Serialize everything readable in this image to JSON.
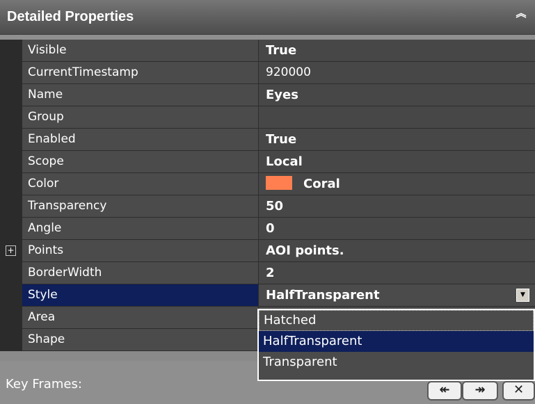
{
  "header": {
    "title": "Detailed Properties",
    "collapse_icon": "double-chevron-up-icon"
  },
  "properties": [
    {
      "name": "Visible",
      "value": "True"
    },
    {
      "name": "CurrentTimestamp",
      "value": "920000"
    },
    {
      "name": "Name",
      "value": "Eyes"
    },
    {
      "name": "Group",
      "value": ""
    },
    {
      "name": "Enabled",
      "value": "True"
    },
    {
      "name": "Scope",
      "value": "Local"
    },
    {
      "name": "Color",
      "value": "Coral",
      "swatch": "#ff7f50"
    },
    {
      "name": "Transparency",
      "value": "50"
    },
    {
      "name": "Angle",
      "value": "0"
    },
    {
      "name": "Points",
      "value": "AOI points.",
      "expander": "+"
    },
    {
      "name": "BorderWidth",
      "value": "2"
    },
    {
      "name": "Style",
      "value": "HalfTransparent",
      "selected": true
    },
    {
      "name": "Area",
      "value": ""
    },
    {
      "name": "Shape",
      "value": ""
    }
  ],
  "style_dropdown": {
    "options": [
      "Hatched",
      "HalfTransparent",
      "Transparent"
    ],
    "highlighted": "HalfTransparent"
  },
  "footer": {
    "label": "Key Frames:",
    "buttons": [
      {
        "icon": "previous-keyframe-icon",
        "glyph": "↞"
      },
      {
        "icon": "next-keyframe-icon",
        "glyph": "↠"
      },
      {
        "icon": "close-icon",
        "glyph": "✕"
      }
    ]
  },
  "colors": {
    "selection": "#0e1f5b",
    "row_bg": "#4b4b4b",
    "coral": "#ff7f50"
  }
}
